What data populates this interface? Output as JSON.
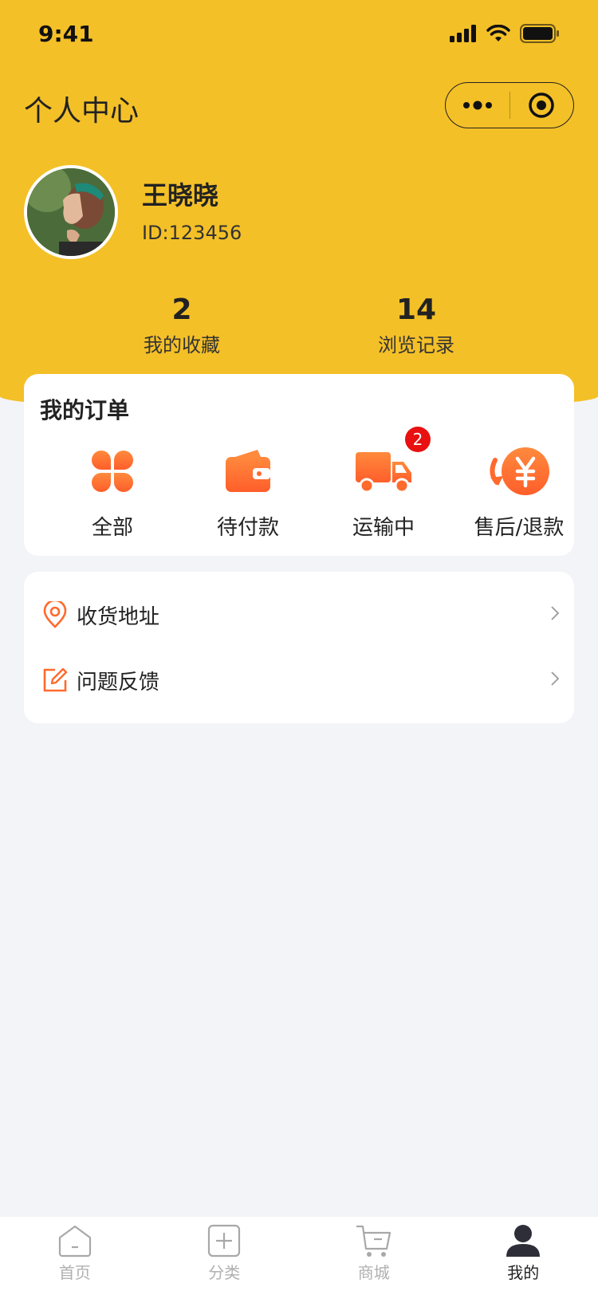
{
  "status_bar": {
    "time": "9:41"
  },
  "nav": {
    "title": "个人中心"
  },
  "user": {
    "name": "王晓晓",
    "id": "ID:123456"
  },
  "stats": [
    {
      "value": "2",
      "label": "我的收藏"
    },
    {
      "value": "14",
      "label": "浏览记录"
    }
  ],
  "orders": {
    "title": "我的订单",
    "items": [
      {
        "label": "全部",
        "icon": "grid-icon"
      },
      {
        "label": "待付款",
        "icon": "wallet-icon"
      },
      {
        "label": "运输中",
        "icon": "truck-icon",
        "badge": "2"
      },
      {
        "label": "售后/退款",
        "icon": "refund-icon"
      }
    ]
  },
  "menu": [
    {
      "label": "收货地址",
      "icon": "location-icon"
    },
    {
      "label": "问题反馈",
      "icon": "edit-icon"
    }
  ],
  "tabbar": [
    {
      "label": "首页",
      "icon": "home-icon"
    },
    {
      "label": "分类",
      "icon": "category-icon"
    },
    {
      "label": "商城",
      "icon": "cart-icon"
    },
    {
      "label": "我的",
      "icon": "user-icon",
      "active": true
    }
  ],
  "colors": {
    "header": "#f4c027",
    "accent": "#ff6f2c",
    "badge": "#e81010",
    "background": "#f3f4f8"
  }
}
